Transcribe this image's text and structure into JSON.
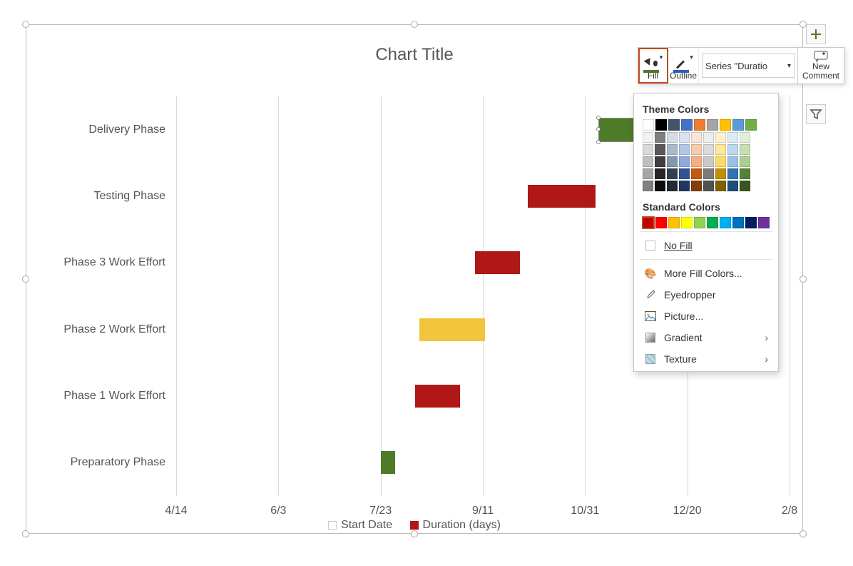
{
  "chart_data": {
    "type": "bar",
    "title": "Chart Title",
    "xlabel": "",
    "ylabel": "",
    "x_axis": {
      "min_serial": 41743,
      "max_serial": 42043,
      "ticks": [
        {
          "serial": 41743,
          "label": "4/14"
        },
        {
          "serial": 41793,
          "label": "6/3"
        },
        {
          "serial": 41843,
          "label": "7/23"
        },
        {
          "serial": 41893,
          "label": "9/11"
        },
        {
          "serial": 41943,
          "label": "10/31"
        },
        {
          "serial": 41993,
          "label": "12/20"
        },
        {
          "serial": 42043,
          "label": "2/8"
        }
      ]
    },
    "categories": [
      "Delivery Phase",
      "Testing Phase",
      "Phase 3 Work Effort",
      "Phase 2 Work Effort",
      "Phase 1 Work Effort",
      "Preparatory Phase"
    ],
    "series": [
      {
        "name": "Start Date",
        "values": [
          41950,
          41915,
          41889,
          41862,
          41860,
          41843
        ],
        "fill": "transparent"
      },
      {
        "name": "Duration (days)",
        "values": [
          30,
          33,
          22,
          32,
          22,
          7
        ],
        "fill_per_point": [
          "#4f7a28",
          "#b01717",
          "#b01717",
          "#f1c43c",
          "#b01717",
          "#4f7a28"
        ]
      }
    ],
    "selected_point": {
      "series": "Duration (days)",
      "category": "Delivery Phase"
    },
    "legend_items": [
      {
        "label": "Start Date",
        "swatch": "#ffffff00"
      },
      {
        "label": "Duration (days)",
        "swatch": "#b01717"
      }
    ]
  },
  "toolbar": {
    "fill_label": "Fill",
    "outline_label": "Outline",
    "series_selector": "Series \"Duratio",
    "new_comment_line1": "New",
    "new_comment_line2": "Comment"
  },
  "fill_menu": {
    "theme_colors_label": "Theme Colors",
    "standard_colors_label": "Standard Colors",
    "no_fill": "No Fill",
    "more_colors": "More Fill Colors...",
    "eyedropper": "Eyedropper",
    "picture": "Picture...",
    "gradient": "Gradient",
    "texture": "Texture",
    "theme_main": [
      "#ffffff",
      "#000000",
      "#44546a",
      "#4472c4",
      "#ed7d31",
      "#a5a5a5",
      "#ffc000",
      "#5b9bd5",
      "#70ad47"
    ],
    "theme_shades": [
      [
        "#f2f2f2",
        "#7f7f7f",
        "#d6dce4",
        "#d9e1f2",
        "#fce4d6",
        "#ededed",
        "#fff2cc",
        "#ddebf7",
        "#e2efda"
      ],
      [
        "#d9d9d9",
        "#595959",
        "#acb9ca",
        "#b4c6e7",
        "#f8cbad",
        "#dbdbdb",
        "#ffe699",
        "#bdd7ee",
        "#c6e0b4"
      ],
      [
        "#bfbfbf",
        "#404040",
        "#8497b0",
        "#8ea9db",
        "#f4b084",
        "#c9c9c9",
        "#ffd966",
        "#9bc2e6",
        "#a9d08e"
      ],
      [
        "#a6a6a6",
        "#262626",
        "#333f4f",
        "#305496",
        "#c65911",
        "#7b7b7b",
        "#bf8f00",
        "#2f75b5",
        "#548235"
      ],
      [
        "#808080",
        "#0d0d0d",
        "#222b35",
        "#203764",
        "#833c0c",
        "#525252",
        "#806000",
        "#1f4e78",
        "#375623"
      ]
    ],
    "standard": [
      "#c00000",
      "#ff0000",
      "#ffc000",
      "#ffff00",
      "#92d050",
      "#00b050",
      "#00b0f0",
      "#0070c0",
      "#002060",
      "#7030a0"
    ],
    "standard_selected_index": 0
  }
}
